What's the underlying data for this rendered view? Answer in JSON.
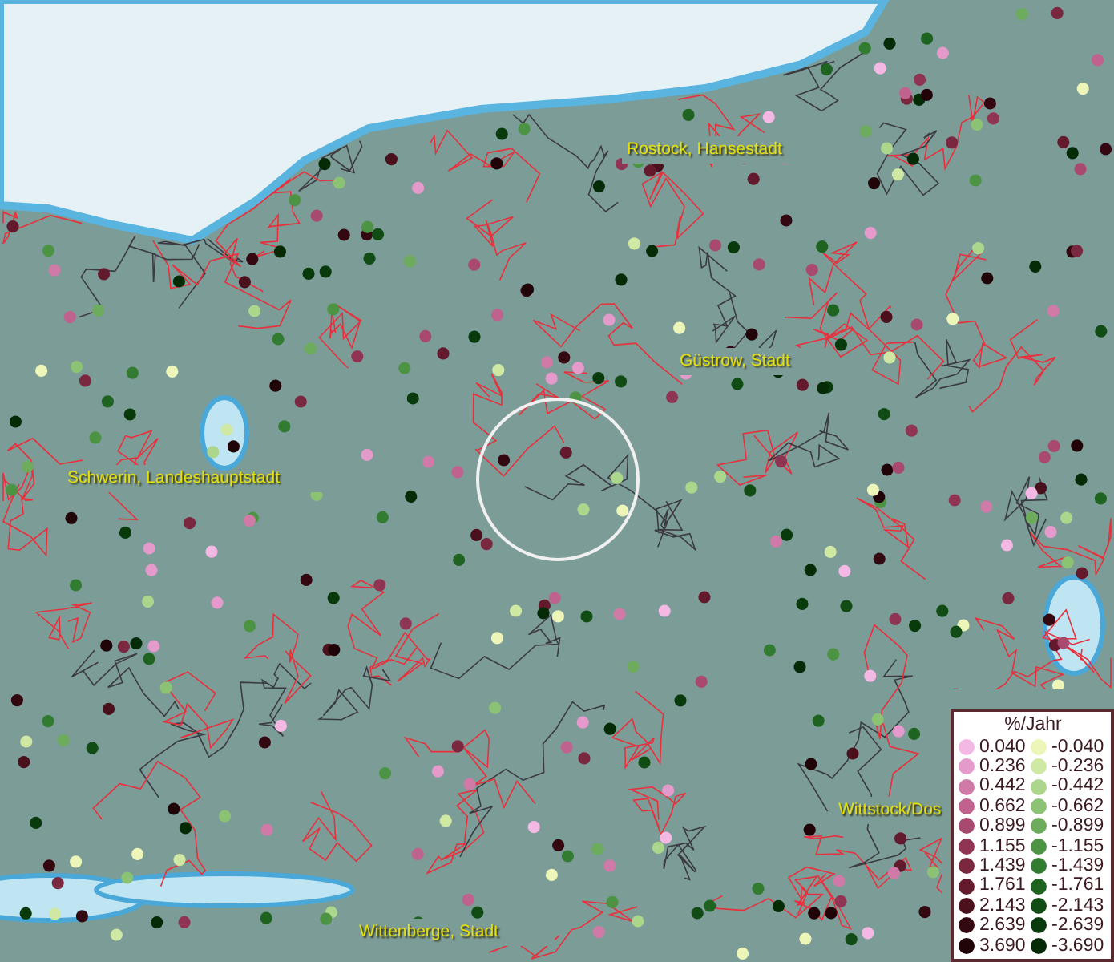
{
  "map": {
    "places": [
      {
        "name": "Rostock, Hansestadt"
      },
      {
        "name": "Güstrow, Stadt"
      },
      {
        "name": "Schwerin, Landeshauptstadt"
      },
      {
        "name": "Wittstock/Dos"
      },
      {
        "name": "Wittenberge, Stadt"
      }
    ]
  },
  "legend": {
    "title": "%/Jahr",
    "rows": [
      {
        "left": {
          "label": "0.040",
          "color": "#f4b8e4"
        },
        "right": {
          "label": "-0.040",
          "color": "#eef5b8"
        }
      },
      {
        "left": {
          "label": "0.236",
          "color": "#e49acb"
        },
        "right": {
          "label": "-0.236",
          "color": "#cfe8a4"
        }
      },
      {
        "left": {
          "label": "0.442",
          "color": "#d07aa8"
        },
        "right": {
          "label": "-0.442",
          "color": "#acd68c"
        }
      },
      {
        "left": {
          "label": "0.662",
          "color": "#c0628e"
        },
        "right": {
          "label": "-0.662",
          "color": "#8cc274"
        }
      },
      {
        "left": {
          "label": "0.899",
          "color": "#a84a70"
        },
        "right": {
          "label": "-0.899",
          "color": "#6cac5c"
        }
      },
      {
        "left": {
          "label": "1.155",
          "color": "#903454"
        },
        "right": {
          "label": "-1.155",
          "color": "#4c9444"
        }
      },
      {
        "left": {
          "label": "1.439",
          "color": "#7a2840"
        },
        "right": {
          "label": "-1.439",
          "color": "#327c32"
        }
      },
      {
        "left": {
          "label": "1.761",
          "color": "#621a2c"
        },
        "right": {
          "label": "-1.761",
          "color": "#1e6420"
        }
      },
      {
        "left": {
          "label": "2.143",
          "color": "#4a101c"
        },
        "right": {
          "label": "-2.143",
          "color": "#104c14"
        }
      },
      {
        "left": {
          "label": "2.639",
          "color": "#340810"
        },
        "right": {
          "label": "-2.639",
          "color": "#083a0c"
        }
      },
      {
        "left": {
          "label": "3.690",
          "color": "#200408"
        },
        "right": {
          "label": "-3.690",
          "color": "#042a06"
        }
      }
    ]
  }
}
